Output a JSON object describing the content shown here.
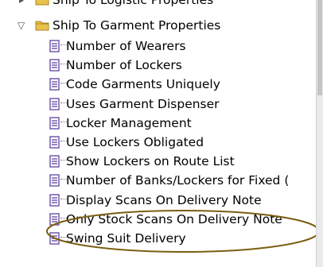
{
  "tree": {
    "parent_above": "Ship To Logistic Properties",
    "parent_node": "Ship To Garment Properties",
    "toggle_glyph": "▽",
    "items": [
      "Number of Wearers",
      "Number of Lockers",
      "Code Garments Uniquely",
      "Uses Garment Dispenser",
      "Locker Management",
      "Use Lockers Obligated",
      "Show Lockers on Route List",
      "Number of Banks/Lockers for Fixed (",
      "Display Scans On Delivery Note",
      "Only Stock Scans On Delivery Note",
      "Swing Suit Delivery"
    ]
  },
  "colors": {
    "folder": "#e8c24a",
    "doc_icon": "#6a4fa8",
    "highlight_ellipse": "#7a5f12"
  },
  "icons": {
    "folder": "folder-icon",
    "property": "property-icon"
  }
}
